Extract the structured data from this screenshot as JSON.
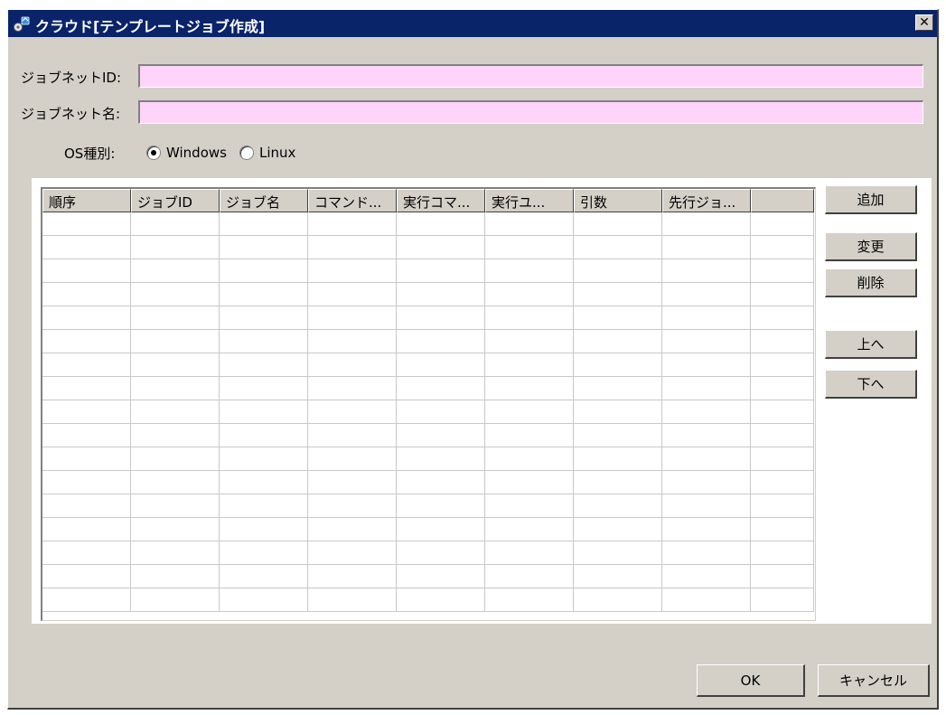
{
  "window": {
    "title": "クラウド[テンプレートジョブ作成]",
    "close_symbol": "✕",
    "icon": "app-gear-icon"
  },
  "form": {
    "jobnet_id_label": "ジョブネットID:",
    "jobnet_id_value": "",
    "jobnet_name_label": "ジョブネット名:",
    "jobnet_name_value": "",
    "os_label": "OS種別:",
    "os_options": [
      {
        "label": "Windows",
        "checked": true
      },
      {
        "label": "Linux",
        "checked": false
      }
    ]
  },
  "table": {
    "columns": [
      "順序",
      "ジョブID",
      "ジョブ名",
      "コマンド...",
      "実行コマ...",
      "実行ユ...",
      "引数",
      "先行ジョ...",
      ""
    ],
    "rows": 17
  },
  "side_buttons": {
    "add": "追加",
    "modify": "変更",
    "delete": "削除",
    "up": "上へ",
    "down": "下へ"
  },
  "footer": {
    "ok": "OK",
    "cancel": "キャンセル"
  },
  "colors": {
    "titlebar": "#0a246a",
    "input_bg": "#ffd4fb",
    "face": "#d4d0c8"
  }
}
